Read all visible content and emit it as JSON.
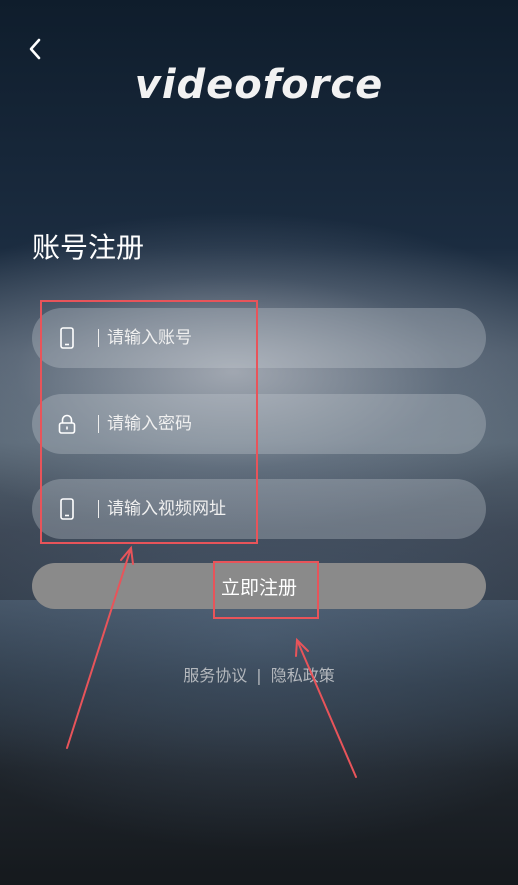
{
  "app": {
    "logo": "videoforce"
  },
  "header": {
    "back_icon": "chevron-left-icon"
  },
  "page": {
    "title": "账号注册"
  },
  "form": {
    "fields": [
      {
        "icon": "phone-icon",
        "placeholder": "请输入账号",
        "value": ""
      },
      {
        "icon": "lock-icon",
        "placeholder": "请输入密码",
        "value": ""
      },
      {
        "icon": "phone-icon",
        "placeholder": "请输入视频网址",
        "value": ""
      }
    ],
    "submit_label": "立即注册"
  },
  "links": {
    "terms": "服务协议",
    "separator": "|",
    "privacy": "隐私政策"
  },
  "annotations": {
    "color": "#e8545a"
  }
}
